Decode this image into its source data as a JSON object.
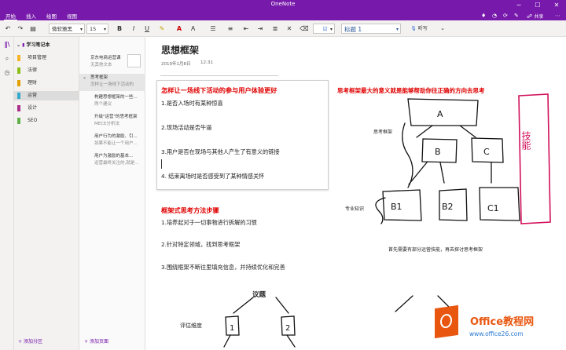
{
  "window": {
    "title": "OneNote"
  },
  "ribbon": {
    "tabs": [
      "开始",
      "插入",
      "绘图",
      "视图"
    ],
    "share": "共享"
  },
  "toolbar": {
    "font": "微软雅黑",
    "size": "15",
    "bold": "B",
    "italic": "I",
    "underline": "U",
    "style": "标题 1",
    "dictate": "听写"
  },
  "notebook": {
    "name": "学习笔记本"
  },
  "sections": [
    {
      "label": "项目管理",
      "color": "#f5b428"
    },
    {
      "label": "法律",
      "color": "#8cbd18"
    },
    {
      "label": "理财",
      "color": "#e0a000"
    },
    {
      "label": "运营",
      "color": "#33aacc"
    },
    {
      "label": "设计",
      "color": "#a9318c"
    },
    {
      "label": "SEO",
      "color": "#60b14c"
    }
  ],
  "pages": [
    {
      "title": "京东电商运营课",
      "preview": "无其他文本"
    },
    {
      "title": "思考框架",
      "preview": "怎样让一场线下活动的"
    },
    {
      "title": "构建思想框架的一些...",
      "preview": "两个建议"
    },
    {
      "title": "升级\"运营\"的思考框架",
      "preview": "MECE分析法"
    },
    {
      "title": "用户行为的激励、引...",
      "preview": "如果不能让一个用户..."
    },
    {
      "title": "用户为激励的基本...",
      "preview": "运营最终关注的,就是..."
    }
  ],
  "footer": {
    "add_section": "添加分区",
    "add_page": "添加页面"
  },
  "page": {
    "title": "思想框架",
    "date": "2019年1月8日",
    "time": "12:31",
    "h1": "怎样让一场线下活动的参与用户体验更好",
    "items1": [
      "1.是否入场时有某种惊喜",
      "2.现场活动是否牛逼",
      "3.用户是否在现场与其他人产生了有意义的链接",
      "4. 结束离场时是否感受到了某种情感关怀"
    ],
    "h2": "框架式思考方法步骤",
    "items2": [
      "1.培养起对于一切事物进行拆解的习惯",
      "2.针对特定领域，找到思考框架",
      "3.围绕框架不断往里填充信息，并持续优化和完善"
    ],
    "topic": "议题",
    "eval": "评估维度",
    "right_heading": "思考框架最大的意义就是能够帮助你往正确的方向去思考",
    "label_framework": "思考框架",
    "label_knowledge": "专业知识",
    "caption": "首先需要有部分运营技能，再去探讨思考框架",
    "diagram_letters": [
      "A",
      "B",
      "C",
      "B1",
      "B2",
      "C1"
    ],
    "handwritten_side": "技能",
    "bottom_nodes": [
      "1",
      "2"
    ]
  },
  "watermark": {
    "brand": "Office教程网",
    "url": "www.office26.com"
  }
}
